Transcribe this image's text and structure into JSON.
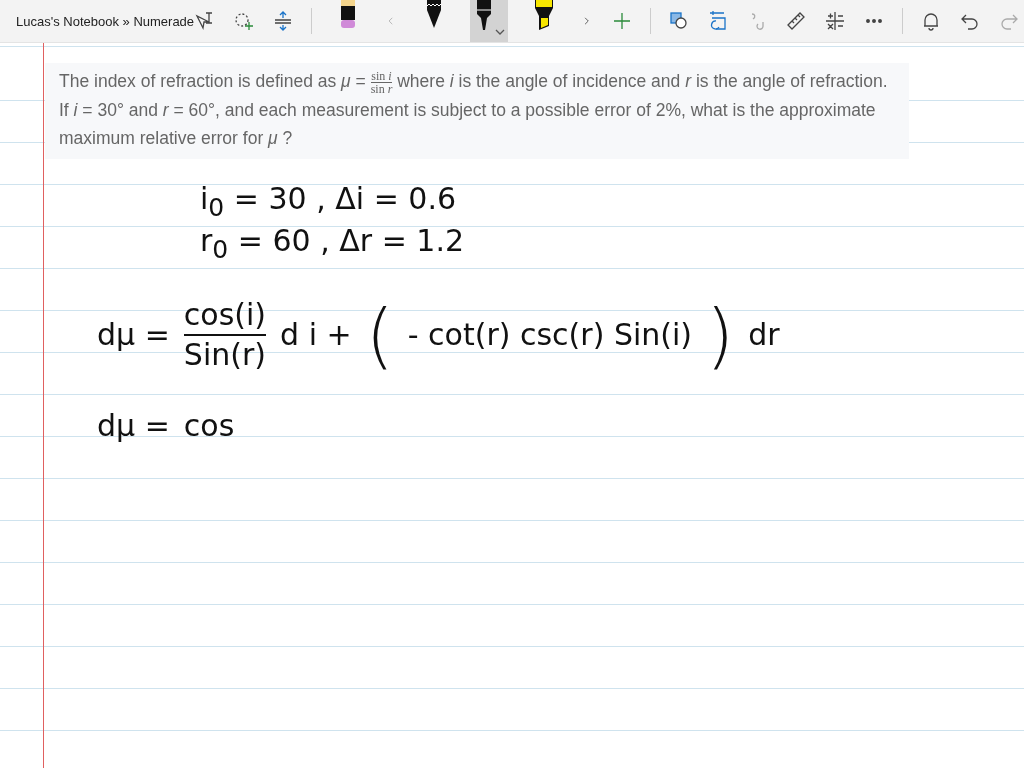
{
  "window": {
    "title": "Lucas's Notebook » Numerade"
  },
  "pens": [
    {
      "kind": "eraser",
      "selected": false
    },
    {
      "kind": "pencil",
      "selected": false
    },
    {
      "kind": "pen",
      "selected": true
    },
    {
      "kind": "highlighter",
      "selected": false
    }
  ],
  "question": {
    "before": "The index of refraction is defined as *μ* = ",
    "numerator": "sin *i*",
    "denominator": "sin *r*",
    "after": " where *i* is the angle of incidence and *r* is the angle of refraction. If *i* = 30° and *r* = 60°, and each measurement is subject to a possible error of 2%, what is the approximate maximum relative error for *μ* ?"
  },
  "ink": [
    {
      "kind": "given",
      "segments": [
        {
          "kind": "text",
          "text": "i$_{0}$ = 30 ,   Δi = 0.6"
        }
      ]
    },
    {
      "kind": "given",
      "segments": [
        {
          "kind": "text",
          "text": "r$_{0}$ = 60 ,   Δr = 1.2"
        }
      ]
    },
    {
      "kind": "equation",
      "segments": [
        {
          "kind": "text",
          "text": "dμ ="
        },
        {
          "kind": "fraction",
          "numerator": "cos(i)",
          "denominator": "Sin(r)"
        },
        {
          "kind": "text",
          "text": "d i  +"
        },
        {
          "kind": "paren",
          "text": "("
        },
        {
          "kind": "text",
          "text": "- cot(r) csc(r) Sin(i)"
        },
        {
          "kind": "paren",
          "text": ")"
        },
        {
          "kind": "text",
          "text": "dr"
        }
      ]
    },
    {
      "kind": "equation",
      "segments": [
        {
          "kind": "text",
          "text": "dμ ="
        },
        {
          "kind": "text",
          "text": "cos"
        }
      ]
    }
  ]
}
